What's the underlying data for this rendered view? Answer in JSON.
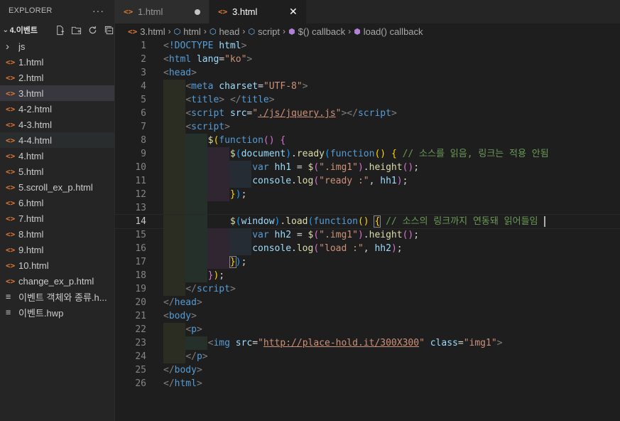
{
  "sidebar": {
    "title": "EXPLORER",
    "more": "···",
    "folder": "4.이벤트",
    "items": [
      {
        "label": "js",
        "type": "folder"
      },
      {
        "label": "1.html",
        "type": "html"
      },
      {
        "label": "2.html",
        "type": "html"
      },
      {
        "label": "3.html",
        "type": "html",
        "selected": true
      },
      {
        "label": "4-2.html",
        "type": "html"
      },
      {
        "label": "4-3.html",
        "type": "html"
      },
      {
        "label": "4-4.html",
        "type": "html",
        "hover": true
      },
      {
        "label": "4.html",
        "type": "html"
      },
      {
        "label": "5.html",
        "type": "html"
      },
      {
        "label": "5.scroll_ex_p.html",
        "type": "html"
      },
      {
        "label": "6.html",
        "type": "html"
      },
      {
        "label": "7.html",
        "type": "html"
      },
      {
        "label": "8.html",
        "type": "html"
      },
      {
        "label": "9.html",
        "type": "html"
      },
      {
        "label": "10.html",
        "type": "html"
      },
      {
        "label": "change_ex_p.html",
        "type": "html"
      },
      {
        "label": "이벤트 객체와 종류.h...",
        "type": "text"
      },
      {
        "label": "이벤트.hwp",
        "type": "text"
      }
    ]
  },
  "tabs": [
    {
      "label": "1.html",
      "active": false,
      "modified": true
    },
    {
      "label": "3.html",
      "active": true,
      "modified": false
    }
  ],
  "breadcrumb": [
    {
      "label": "3.html",
      "icon": "html-icon"
    },
    {
      "label": "html",
      "icon": "cube-icon"
    },
    {
      "label": "head",
      "icon": "cube-icon"
    },
    {
      "label": "script",
      "icon": "cube-icon"
    },
    {
      "label": "$() callback",
      "icon": "function-icon"
    },
    {
      "label": "load() callback",
      "icon": "function-icon"
    }
  ],
  "editor": {
    "current_line": 14,
    "lines": [
      {
        "n": "1",
        "guides": 0,
        "html": "<span class='p'>&lt;</span><span class='t'>!DOCTYPE</span> <span class='a'>html</span><span class='p'>&gt;</span>"
      },
      {
        "n": "2",
        "guides": 0,
        "html": "<span class='p'>&lt;</span><span class='t'>html</span> <span class='a'>lang</span>=<span class='s'>\"ko\"</span><span class='p'>&gt;</span>"
      },
      {
        "n": "3",
        "guides": 0,
        "html": "<span class='p'>&lt;</span><span class='t'>head</span><span class='p'>&gt;</span>"
      },
      {
        "n": "4",
        "guides": 1,
        "html": "    <span class='p'>&lt;</span><span class='t'>meta</span> <span class='a'>charset</span>=<span class='s'>\"UTF-8\"</span><span class='p'>&gt;</span>"
      },
      {
        "n": "5",
        "guides": 1,
        "html": "    <span class='p'>&lt;</span><span class='t'>title</span><span class='p'>&gt;</span> <span class='p'>&lt;/</span><span class='t'>title</span><span class='p'>&gt;</span>"
      },
      {
        "n": "6",
        "guides": 1,
        "html": "    <span class='p'>&lt;</span><span class='t'>script</span> <span class='a'>src</span>=<span class='s'>\"<span class='u'>./js/jquery.js</span>\"</span><span class='p'>&gt;&lt;/</span><span class='t'>script</span><span class='p'>&gt;</span>"
      },
      {
        "n": "7",
        "guides": 1,
        "html": "    <span class='p'>&lt;</span><span class='t'>script</span><span class='p'>&gt;</span>"
      },
      {
        "n": "8",
        "guides": 2,
        "html": "        <span class='f'>$</span><span class='y'>(</span><span class='t'>function</span><span class='m'>()</span> <span class='m'>{</span>"
      },
      {
        "n": "9",
        "guides": 3,
        "html": "            <span class='f'>$</span><span class='b'>(</span><span class='a'>document</span><span class='b'>)</span>.<span class='f'>ready</span><span class='b'>(</span><span class='t'>function</span><span class='y'>()</span> <span class='y'>{</span> <span class='c'>// 소스를 읽음, 링크는 적용 안됨</span>"
      },
      {
        "n": "10",
        "guides": 4,
        "html": "                <span class='t'>var</span> <span class='a'>hh1</span> = <span class='f'>$</span><span class='m'>(</span><span class='s'>\".img1\"</span><span class='m'>)</span>.<span class='f'>height</span><span class='m'>()</span>;"
      },
      {
        "n": "11",
        "guides": 4,
        "html": "                <span class='a'>console</span>.<span class='f'>log</span><span class='m'>(</span><span class='s'>\"ready :\"</span>, <span class='a'>hh1</span><span class='m'>)</span>;"
      },
      {
        "n": "12",
        "guides": 3,
        "html": "            <span class='y'>}</span><span class='b'>)</span>;"
      },
      {
        "n": "13",
        "guides": 2,
        "html": ""
      },
      {
        "n": "14",
        "guides": 2,
        "html": "            <span class='f'>$</span><span class='b'>(</span><span class='a'>window</span><span class='b'>)</span>.<span class='f'>load</span><span class='b'>(</span><span class='t'>function</span><span class='y'>()</span> <span class='y bracket-box'>{</span> <span class='c'>// 소스의 링크까지 연동돼 읽어들임</span> <span class='cursor'></span>"
      },
      {
        "n": "15",
        "guides": 4,
        "html": "                <span class='t'>var</span> <span class='a'>hh2</span> = <span class='f'>$</span><span class='m'>(</span><span class='s'>\".img1\"</span><span class='m'>)</span>.<span class='f'>height</span><span class='m'>()</span>;"
      },
      {
        "n": "16",
        "guides": 4,
        "html": "                <span class='a'>console</span>.<span class='f'>log</span><span class='m'>(</span><span class='s'>\"load :\"</span>, <span class='a'>hh2</span><span class='m'>)</span>;"
      },
      {
        "n": "17",
        "guides": 3,
        "html": "            <span class='y bracket-box'>}</span><span class='b'>)</span>;"
      },
      {
        "n": "18",
        "guides": 2,
        "html": "        <span class='m'>}</span><span class='y'>)</span>;"
      },
      {
        "n": "19",
        "guides": 1,
        "html": "    <span class='p'>&lt;/</span><span class='t'>script</span><span class='p'>&gt;</span>"
      },
      {
        "n": "20",
        "guides": 0,
        "html": "<span class='p'>&lt;/</span><span class='t'>head</span><span class='p'>&gt;</span>"
      },
      {
        "n": "21",
        "guides": 0,
        "html": "<span class='p'>&lt;</span><span class='t'>body</span><span class='p'>&gt;</span>"
      },
      {
        "n": "22",
        "guides": 1,
        "html": "    <span class='p'>&lt;</span><span class='t'>p</span><span class='p'>&gt;</span>"
      },
      {
        "n": "23",
        "guides": 2,
        "html": "        <span class='p'>&lt;</span><span class='t'>img</span> <span class='a'>src</span>=<span class='s'>\"<span class='u'>http://place-hold.it/300X300</span>\"</span> <span class='a'>class</span>=<span class='s'>\"img1\"</span><span class='p'>&gt;</span>"
      },
      {
        "n": "24",
        "guides": 1,
        "html": "    <span class='p'>&lt;/</span><span class='t'>p</span><span class='p'>&gt;</span>"
      },
      {
        "n": "25",
        "guides": 0,
        "html": "<span class='p'>&lt;/</span><span class='t'>body</span><span class='p'>&gt;</span>"
      },
      {
        "n": "26",
        "guides": 0,
        "html": "<span class='p'>&lt;/</span><span class='t'>html</span><span class='p'>&gt;</span>"
      }
    ]
  }
}
